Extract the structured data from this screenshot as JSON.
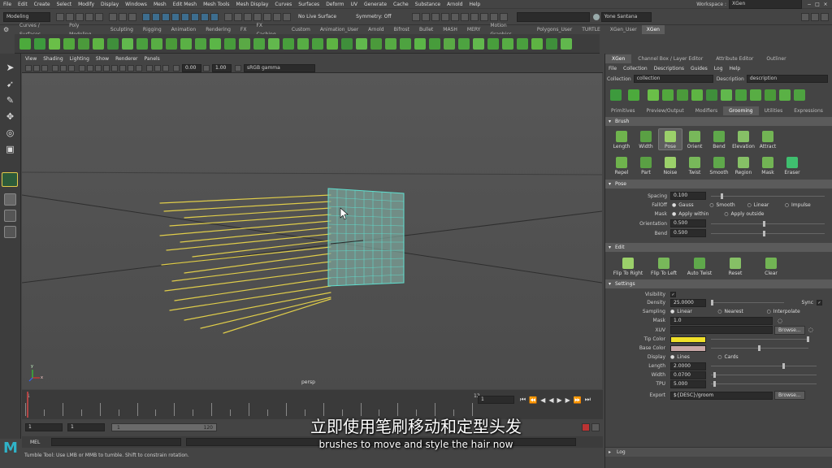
{
  "menubar": {
    "items": [
      "File",
      "Edit",
      "Create",
      "Select",
      "Modify",
      "Display",
      "Windows",
      "Mesh",
      "Edit Mesh",
      "Mesh Tools",
      "Mesh Display",
      "Curves",
      "Surfaces",
      "Deform",
      "UV",
      "Generate",
      "Cache",
      "Substance",
      "Arnold",
      "Help"
    ],
    "workspace_label": "Workspace :",
    "workspace_value": "XGen"
  },
  "statusline": {
    "mode_value": "Modeling",
    "live_surface": "No Live Surface",
    "symmetry": "Symmetry: Off",
    "user": "Yone Santana"
  },
  "shelf": {
    "tabs": [
      "Curves / Surfaces",
      "Poly Modeling",
      "Sculpting",
      "Rigging",
      "Animation",
      "Rendering",
      "FX",
      "FX Caching",
      "Custom",
      "Animation_User",
      "Arnold",
      "Bifrost",
      "Bullet",
      "MASH",
      "MERY",
      "Motion Graphics",
      "Polygons_User",
      "TURTLE",
      "XGen_User",
      "XGen"
    ],
    "active_tab": "XGen"
  },
  "viewport": {
    "menu": [
      "View",
      "Shading",
      "Lighting",
      "Show",
      "Renderer",
      "Panels"
    ],
    "value_a": "0.00",
    "value_b": "1.00",
    "color_space": "sRGB gamma",
    "camera_label": "persp",
    "axis_y": "y",
    "axis_x": "x"
  },
  "timeline": {
    "ticks": [
      "1",
      "",
      "",
      "",
      "",
      "",
      "",
      "",
      "",
      "",
      "",
      "",
      "",
      "",
      "",
      "",
      "",
      "",
      "",
      "",
      "",
      "",
      "",
      "",
      "12"
    ],
    "current_frame": "1",
    "range_start": "1",
    "range_inner_start": "1",
    "range_inner_label": "1",
    "range_end_inner": "120"
  },
  "cmdline": {
    "label": "MEL"
  },
  "helpline": {
    "text": "Tumble Tool: Use LMB or MMB to tumble. Shift to constrain rotation."
  },
  "rightpanel": {
    "top_tabs": [
      "XGen",
      "Channel Box / Layer Editor",
      "Attribute Editor",
      "Outliner"
    ],
    "menu": [
      "File",
      "Collection",
      "Descriptions",
      "Guides",
      "Log",
      "Help"
    ],
    "collection_label": "Collection",
    "collection_value": "collection",
    "description_label": "Description",
    "description_value": "description",
    "sub_tabs": [
      "Primitives",
      "Preview/Output",
      "Modifiers",
      "Grooming",
      "Utilities",
      "Expressions"
    ],
    "active_sub_tab": "Grooming",
    "brush_section": "Brush",
    "brushes_row1": [
      "Length",
      "Width",
      "Pose",
      "Orient",
      "Bend",
      "Elevation",
      "Attract"
    ],
    "brushes_row2": [
      "Repel",
      "Part",
      "Noise",
      "Twist",
      "Smooth",
      "Region",
      "Mask",
      "Eraser"
    ],
    "pose_section": "Pose",
    "spacing_label": "Spacing",
    "spacing_value": "0.100",
    "falloff_label": "FallOff",
    "falloff_options": [
      "Gauss",
      "Smooth",
      "Linear",
      "Impulse"
    ],
    "mask_label": "Mask",
    "mask_options": [
      "Apply within",
      "Apply outside"
    ],
    "orientation_label": "Orientation",
    "orientation_value": "0.500",
    "bend_label": "Bend",
    "bend_value": "0.500",
    "edit_section": "Edit",
    "edit_buttons": [
      "Flip To Right",
      "Flip To Left",
      "Auto Twist",
      "Reset",
      "Clear"
    ],
    "settings_section": "Settings",
    "visibility_label": "Visibility",
    "density_label": "Density",
    "density_value": "25.0000",
    "sync_label": "Sync",
    "sampling_label": "Sampling",
    "sampling_options": [
      "Linear",
      "Nearest",
      "Interpolate"
    ],
    "smask_label": "Mask",
    "smask_value": "1.0",
    "xuv_label": "XUV",
    "browse_label": "Browse...",
    "tipcolor_label": "Tip Color",
    "tipcolor": "#f0e02a",
    "basecolor_label": "Base Color",
    "basecolor": "#c9a7a7",
    "display_label": "Display",
    "display_options": [
      "Lines",
      "Cards"
    ],
    "length_label": "Length",
    "length_value": "2.0000",
    "width_label": "Width",
    "width_value": "0.0700",
    "tpu_label": "TPU",
    "tpu_value": "5.000",
    "export_label": "Export",
    "export_value": "${DESC}/groom",
    "log_label": "Log"
  },
  "subtitles": {
    "chinese": "立即使用笔刷移动和定型头发",
    "english": "brushes to move and style the hair now"
  },
  "colors": {
    "accent_maya": "#2fb3c8",
    "hair_yellow": "#e8d44a",
    "mesh_cyan": "#5fe0d0"
  }
}
